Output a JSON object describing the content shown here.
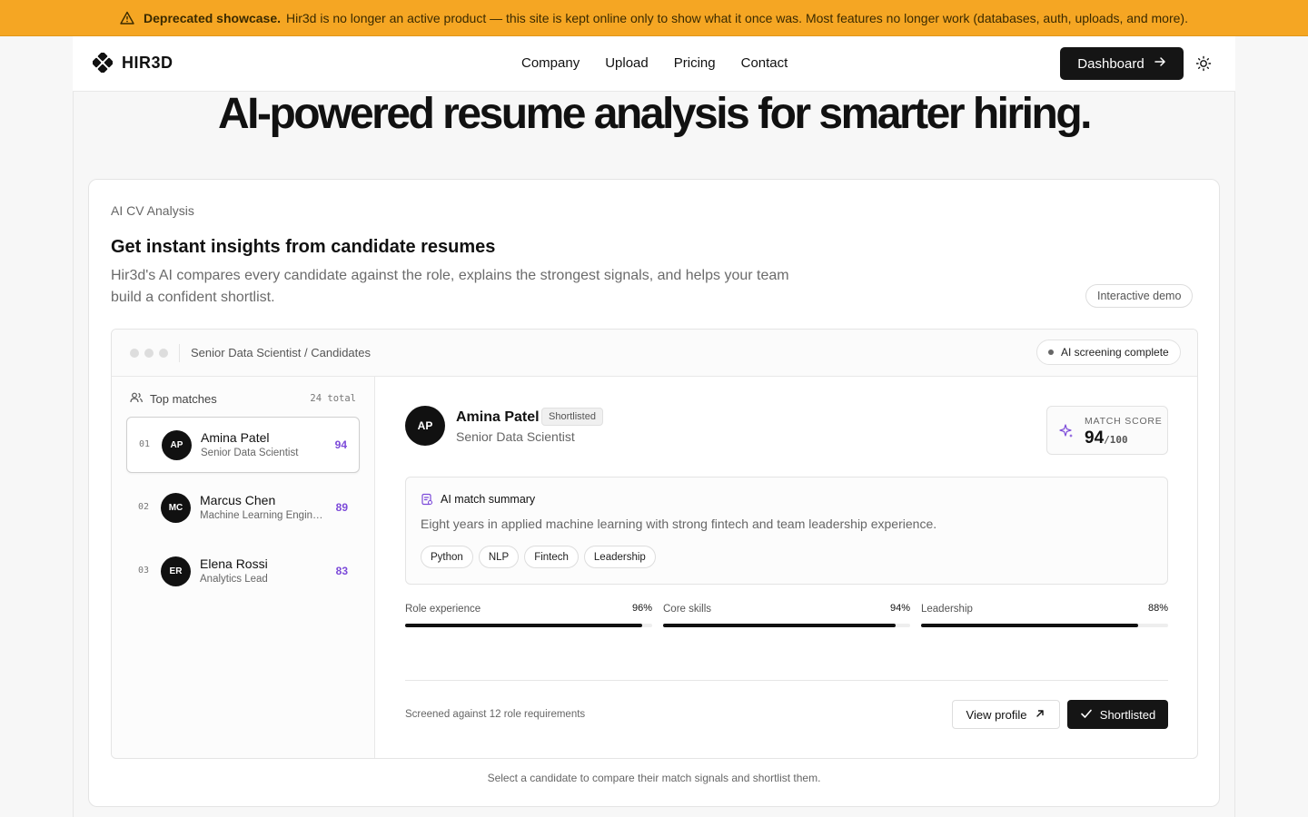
{
  "banner": {
    "icon": "warning-icon",
    "strong": "Deprecated showcase.",
    "text": "Hir3d is no longer an active product — this site is kept online only to show what it once was. Most features no longer work (databases, auth, uploads, and more)."
  },
  "nav": {
    "logo_text": "HIR3D",
    "links": [
      "Company",
      "Upload",
      "Pricing",
      "Contact"
    ],
    "dashboard_label": "Dashboard",
    "theme_icon": "sun-icon"
  },
  "hero": {
    "title": "AI-powered resume analysis for smarter hiring."
  },
  "card": {
    "eyebrow": "AI CV Analysis",
    "title": "Get instant insights from candidate resumes",
    "description": "Hir3d's AI compares every candidate against the role, explains the strongest signals, and helps your team build a confident shortlist.",
    "demo_badge": "Interactive demo",
    "caption": "Select a candidate to compare their match signals and shortlist them."
  },
  "app": {
    "breadcrumb": "Senior Data Scientist / Candidates",
    "status": "AI screening complete",
    "sidebar": {
      "heading": "Top matches",
      "total": "24 total",
      "candidates": [
        {
          "rank": "01",
          "initials": "AP",
          "name": "Amina Patel",
          "role": "Senior Data Scientist",
          "score": "94"
        },
        {
          "rank": "02",
          "initials": "MC",
          "name": "Marcus Chen",
          "role": "Machine Learning Engineer",
          "score": "89"
        },
        {
          "rank": "03",
          "initials": "ER",
          "name": "Elena Rossi",
          "role": "Analytics Lead",
          "score": "83"
        }
      ]
    },
    "detail": {
      "initials": "AP",
      "name": "Amina Patel",
      "badge": "Shortlisted",
      "role": "Senior Data Scientist",
      "score_label": "MATCH SCORE",
      "score": "94",
      "score_max": "/100",
      "summary_title": "AI match summary",
      "summary_text": "Eight years in applied machine learning with strong fintech and team leadership experience.",
      "tags": [
        "Python",
        "NLP",
        "Fintech",
        "Leadership"
      ],
      "metrics": [
        {
          "label": "Role experience",
          "value": "96%",
          "level": 96
        },
        {
          "label": "Core skills",
          "value": "94%",
          "level": 94
        },
        {
          "label": "Leadership",
          "value": "88%",
          "level": 88
        }
      ],
      "footer_text": "Screened against 12 role requirements",
      "view_label": "View profile",
      "shortlist_label": "Shortlisted"
    }
  },
  "colors": {
    "banner": "#f5a623",
    "accent_score": "#7c4ad9",
    "primary": "#151515"
  }
}
